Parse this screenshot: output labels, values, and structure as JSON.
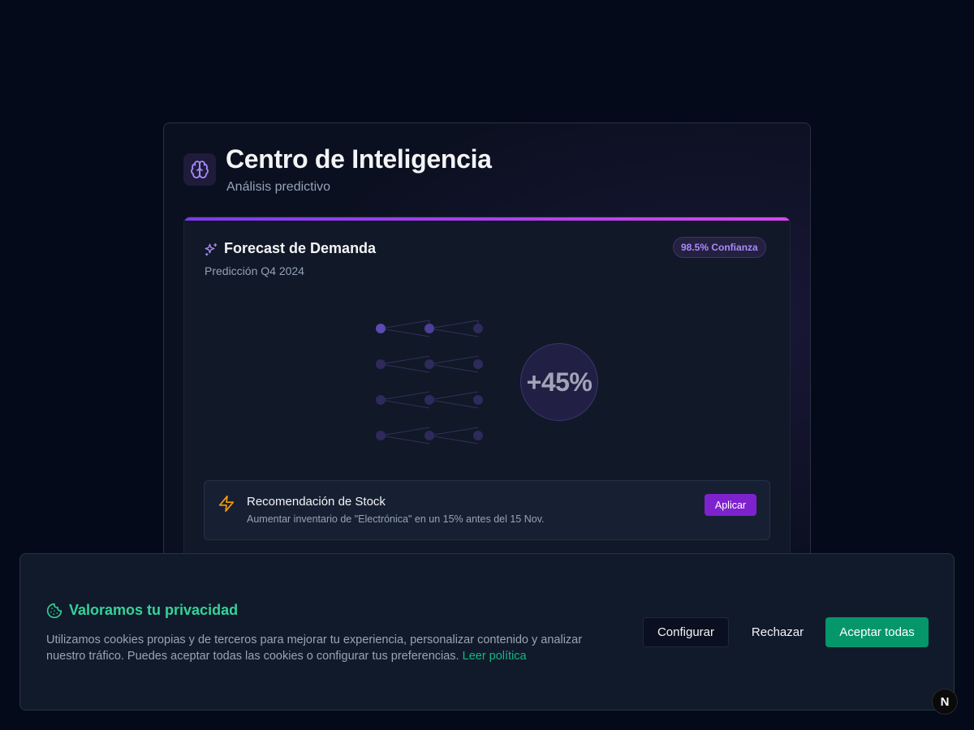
{
  "panel": {
    "title": "Centro de Inteligencia",
    "subtitle": "Análisis predictivo",
    "icon": "brain-icon"
  },
  "forecast": {
    "title": "Forecast de Demanda",
    "subtitle": "Predicción Q4 2024",
    "icon": "sparkles-icon",
    "confidence_badge": "98.5% Confianza",
    "change_value": "+45%",
    "accent_color": "#7c3aed"
  },
  "recommendation": {
    "icon": "bolt-icon",
    "title": "Recomendación de Stock",
    "description": "Aumentar inventario de \"Electrónica\" en un 15% antes del 15 Nov.",
    "action_label": "Aplicar"
  },
  "cookie_banner": {
    "icon": "cookie-icon",
    "title": "Valoramos tu privacidad",
    "text": "Utilizamos cookies propias y de terceros para mejorar tu experiencia, personalizar contenido y analizar nuestro tráfico. Puedes aceptar todas las cookies o configurar tus preferencias.",
    "policy_link": "Leer política",
    "configure_label": "Configurar",
    "reject_label": "Rechazar",
    "accept_label": "Aceptar todas",
    "accent_color": "#10b981"
  },
  "floating_badge": {
    "label": "N"
  }
}
